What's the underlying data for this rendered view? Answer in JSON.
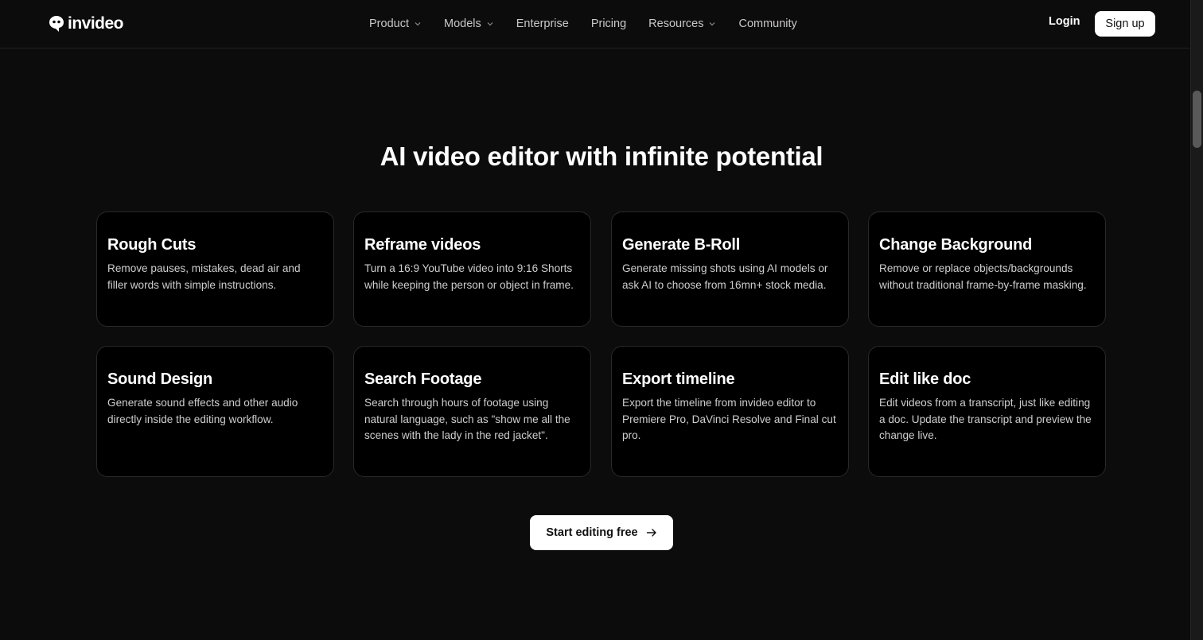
{
  "brand": {
    "name": "invideo",
    "icon": "invideo-logo-icon"
  },
  "nav": {
    "items": [
      {
        "label": "Product",
        "has_dropdown": true
      },
      {
        "label": "Models",
        "has_dropdown": true
      },
      {
        "label": "Enterprise",
        "has_dropdown": false
      },
      {
        "label": "Pricing",
        "has_dropdown": false
      },
      {
        "label": "Resources",
        "has_dropdown": true
      },
      {
        "label": "Community",
        "has_dropdown": false
      }
    ],
    "login_label": "Login",
    "signup_label": "Sign up"
  },
  "section": {
    "title": "AI video editor with infinite potential",
    "cards": [
      {
        "title": "Rough Cuts",
        "description": "Remove pauses, mistakes, dead air and filler words with simple instructions."
      },
      {
        "title": "Reframe videos",
        "description": "Turn a 16:9 YouTube video into 9:16 Shorts while keeping the person or object in frame."
      },
      {
        "title": "Generate B-Roll",
        "description": "Generate missing shots using AI models or ask AI to choose from 16mn+ stock media."
      },
      {
        "title": "Change Background",
        "description": "Remove or replace objects/backgrounds without traditional frame-by-frame masking."
      },
      {
        "title": "Sound Design",
        "description": "Generate sound effects and other audio directly inside the editing workflow."
      },
      {
        "title": "Search Footage",
        "description": "Search through hours of footage using natural language, such as \"show me all the scenes with the lady in the red jacket\"."
      },
      {
        "title": "Export timeline",
        "description": "Export the timeline from invideo editor to Premiere Pro, DaVinci Resolve and Final cut pro."
      },
      {
        "title": "Edit like doc",
        "description": "Edit videos from a transcript, just like editing a doc. Update the transcript and preview the change live."
      }
    ],
    "cta_label": "Start editing free",
    "cta_icon": "arrow-right-icon"
  },
  "colors": {
    "background": "#0d0c0c",
    "card_background": "#000000",
    "button_background": "#ffffff"
  }
}
